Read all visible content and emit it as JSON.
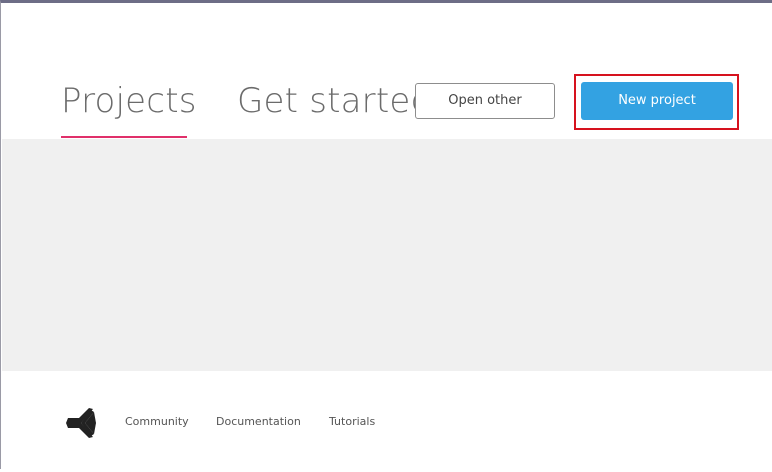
{
  "tabs": [
    {
      "label": "Projects",
      "active": true
    },
    {
      "label": "Get started",
      "active": false
    }
  ],
  "buttons": {
    "open_other": "Open other",
    "new_project": "New project"
  },
  "footer": {
    "logo_icon": "unity-logo-icon",
    "links": [
      "Community",
      "Documentation",
      "Tutorials"
    ]
  },
  "colors": {
    "accent_underline": "#e0306a",
    "primary_button": "#33a2e2",
    "highlight_box": "#d6121e",
    "content_bg": "#f0f0f0"
  }
}
